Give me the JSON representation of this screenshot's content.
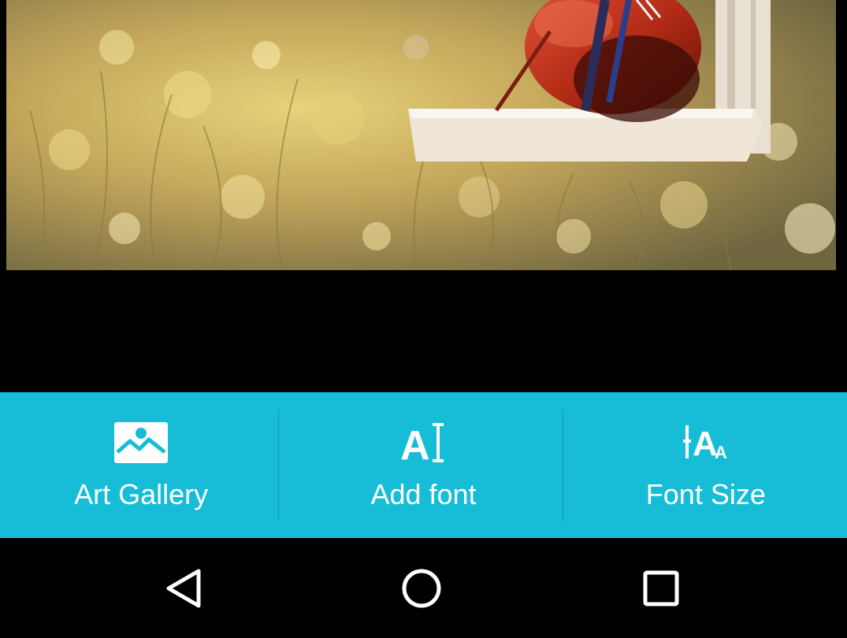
{
  "colors": {
    "toolbar_bg": "#17bcd6",
    "toolbar_text": "#ffffff",
    "nav_bg": "#000000",
    "nav_icon": "#ffffff"
  },
  "image": {
    "description_icon": "violin-on-window-photo"
  },
  "toolbar": {
    "items": [
      {
        "label": "Art Gallery",
        "icon": "image-icon"
      },
      {
        "label": "Add font",
        "icon": "text-cursor-icon"
      },
      {
        "label": "Font Size",
        "icon": "font-size-icon"
      }
    ]
  },
  "navbar": {
    "back_icon": "back-triangle-icon",
    "home_icon": "home-circle-icon",
    "recents_icon": "recents-square-icon"
  }
}
